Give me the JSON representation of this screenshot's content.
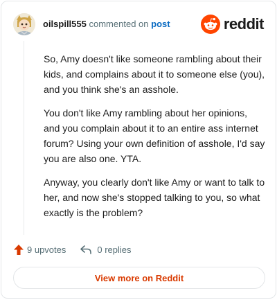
{
  "header": {
    "username": "oilspill555",
    "commented_on": "commented on",
    "post_link": "post",
    "brand_name": "reddit"
  },
  "comment": {
    "paragraphs": [
      "So, Amy doesn't like someone rambling about their kids, and complains about it to someone else (you), and you think she's an asshole.",
      "You don't like Amy rambling about her opinions, and you complain about it to an entire ass internet forum? Using your own definition of asshole, I'd say you are also one. YTA.",
      "Anyway, you clearly don't like Amy or want to talk to her, and now she's stopped talking to you, so what exactly is the problem?"
    ]
  },
  "actions": {
    "upvotes": "9 upvotes",
    "replies": "0 replies"
  },
  "view_more": "View more on Reddit",
  "colors": {
    "brand_orange": "#ff4500",
    "upvote_orange": "#d93a00",
    "link_blue": "#0a6bc2",
    "muted_text": "#576f76"
  },
  "icons": {
    "avatar": "avatar-image",
    "brand": "reddit-snoo-icon",
    "upvote": "upvote-arrow-icon",
    "reply": "reply-arrow-icon"
  }
}
